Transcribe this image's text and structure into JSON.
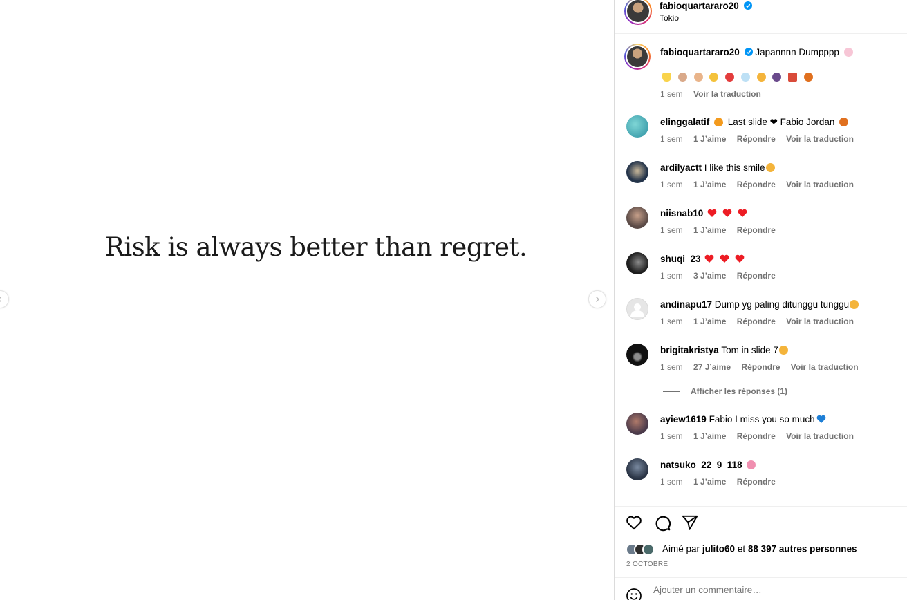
{
  "post": {
    "media_text": "Risk is always better than regret.",
    "author": "fabioquartararo20",
    "location": "Tokio",
    "caption": "Japannnn Dumpppp",
    "caption_time": "1 sem",
    "caption_translate": "Voir la traduction"
  },
  "comments": [
    {
      "user": "elinggalatif",
      "text": "Last slide ❤ Fabio Jordan",
      "time": "1 sem",
      "likes": "1 J’aime",
      "reply": "Répondre",
      "translate": "Voir la traduction"
    },
    {
      "user": "ardilyactt",
      "text": "I like this smile",
      "time": "1 sem",
      "likes": "1 J’aime",
      "reply": "Répondre",
      "translate": "Voir la traduction"
    },
    {
      "user": "niisnab10",
      "text": "",
      "time": "1 sem",
      "likes": "1 J’aime",
      "reply": "Répondre"
    },
    {
      "user": "shuqi_23",
      "text": "",
      "time": "1 sem",
      "likes": "3 J’aime",
      "reply": "Répondre"
    },
    {
      "user": "andinapu17",
      "text": "Dump yg paling ditunggu tunggu",
      "time": "1 sem",
      "likes": "1 J’aime",
      "reply": "Répondre",
      "translate": "Voir la traduction"
    },
    {
      "user": "brigitakristya",
      "text": "Tom in slide 7",
      "time": "1 sem",
      "likes": "27 J’aime",
      "reply": "Répondre",
      "translate": "Voir la traduction",
      "replies": "Afficher les réponses (1)"
    },
    {
      "user": "ayiew1619",
      "text": "Fabio I miss you so much",
      "time": "1 sem",
      "likes": "1 J’aime",
      "reply": "Répondre",
      "translate": "Voir la traduction"
    },
    {
      "user": "natsuko_22_9_118",
      "text": "",
      "time": "1 sem",
      "likes": "1 J’aime",
      "reply": "Répondre"
    }
  ],
  "likes": {
    "prefix": "Aimé par",
    "user": "julito60",
    "joiner": "et",
    "others": "88 397 autres personnes"
  },
  "date": "2 OCTOBRE",
  "add_comment": {
    "placeholder": "Ajouter un commentaire…"
  },
  "colors": {
    "verified": "#0095f6",
    "heart": "#ed1c24",
    "muted": "#737373",
    "border": "#dbdbdb"
  }
}
